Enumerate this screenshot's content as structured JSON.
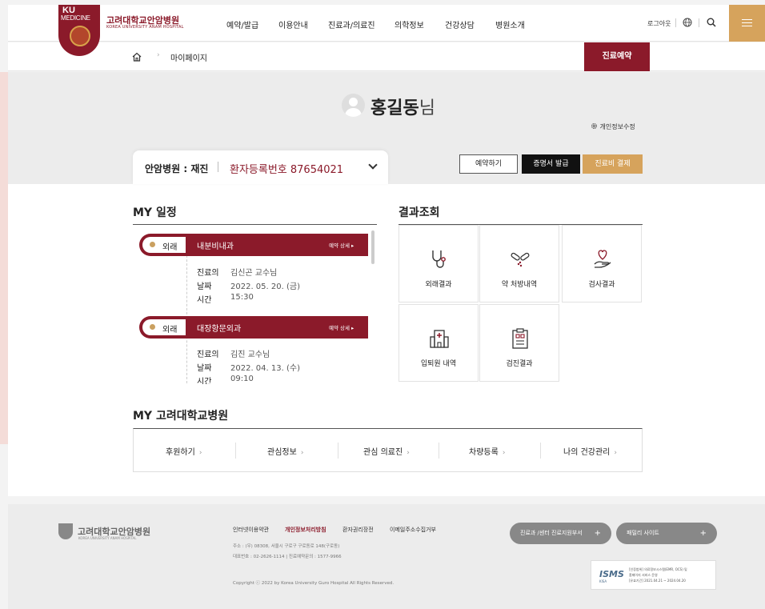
{
  "header": {
    "logo_ku": "KU",
    "logo_medicine": "MEDICINE",
    "hospital_name": "고려대학교안암병원",
    "hospital_name_en": "KOREA UNIVERSITY ANAM HOSPITAL",
    "nav": [
      "예약/발급",
      "이용안내",
      "진료과/의료진",
      "의학정보",
      "건강상담",
      "병원소개"
    ],
    "logout": "로그아웃",
    "globe_icon": "globe-icon",
    "search_icon": "search-icon",
    "menu_icon": "hamburger-icon"
  },
  "breadcrumb": {
    "home_icon": "home-icon",
    "current": "마이페이지",
    "reserve_button": "진료예약"
  },
  "profile": {
    "name": "홍길동",
    "suffix": "님",
    "edit_info": "개인정보수정",
    "hospital_status": "안암병원 : 재진",
    "patient_number": "환자등록번호 87654021"
  },
  "actions": {
    "book": "예약하기",
    "certificate": "증명서 발급",
    "pay": "진료비 결제"
  },
  "schedule": {
    "title": "MY 일정",
    "appointments": [
      {
        "type": "외래",
        "dept": "내분비내과",
        "more": "예약 상세 ▸",
        "doctor_label": "진료의",
        "doctor": "김신곤 교수님",
        "date_label": "날짜",
        "date": "2022. 05. 20. (금)",
        "time_label": "시간",
        "time": "15:30"
      },
      {
        "type": "외래",
        "dept": "대장항문외과",
        "more": "예약 상세 ▸",
        "doctor_label": "진료의",
        "doctor": "김진 교수님",
        "date_label": "날짜",
        "date": "2022. 04. 13. (수)",
        "time_label": "시간",
        "time": "09:10"
      }
    ]
  },
  "results": {
    "title": "결과조회",
    "items": [
      {
        "label": "외래결과",
        "icon": "stethoscope-icon"
      },
      {
        "label": "약 처방내역",
        "icon": "pills-icon"
      },
      {
        "label": "검사결과",
        "icon": "heart-hand-icon"
      },
      {
        "label": "입퇴원 내역",
        "icon": "hospital-building-icon"
      },
      {
        "label": "검진결과",
        "icon": "clipboard-icon"
      }
    ]
  },
  "my_hospital": {
    "title": "MY 고려대학교병원",
    "links": [
      "후원하기",
      "관심정보",
      "관심 의료진",
      "차량등록",
      "나의 건강관리"
    ]
  },
  "footer": {
    "logo": "고려대학교안암병원",
    "logo_sub": "KOREA UNIVERSITY ANAM HOSPITAL",
    "links": [
      "인터넷이용약관",
      "개인정보처리방침",
      "환자권리장전",
      "이메일주소수집거부"
    ],
    "address": "주소 : (우) 08308, 서울시 구로구 구로동로 148(구로동)",
    "phone": "대표번호 : 02-2626-1114  |  진료예약문의 : 1577-9966",
    "copyright": "Copyright ⓒ 2022 by Korea University Guro Hospital All Rights Reserved.",
    "pill_center": "진료과 /센터 진료지원부서",
    "pill_family": "패밀리 사이트",
    "isms_logo": "ISMS",
    "isms_sub": "KISA",
    "isms_line1": "[인증범위] 의료정보시스템(EMR, OCS) 및",
    "isms_line2": "홈페이지 서비스 운영",
    "isms_line3": "[유효기간] 2021.04.21 ~ 2024.04.20"
  },
  "colors": {
    "brand": "#8b1a2a",
    "gold": "#d6a35c"
  }
}
